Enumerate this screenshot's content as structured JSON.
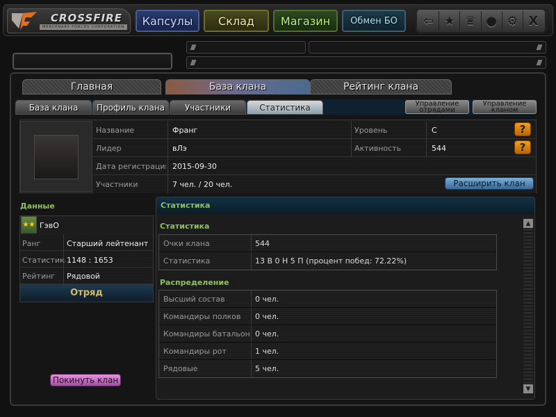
{
  "header": {
    "logo": {
      "title": "CROSSFIRE",
      "subtitle": "MERCENARY FORCES CORPORATION"
    },
    "nav": [
      {
        "label": "Капсулы",
        "color": "#4a5c90"
      },
      {
        "label": "Склад",
        "color": "#6e6e30"
      },
      {
        "label": "Магазин",
        "color": "#4e7030"
      },
      {
        "label": "Обмен БО",
        "color": "#3a6070"
      }
    ],
    "icons": [
      {
        "name": "back-arrow-icon",
        "glyph": "⇦"
      },
      {
        "name": "clan-shield-icon",
        "glyph": "★"
      },
      {
        "name": "trophy-icon",
        "glyph": "♛"
      },
      {
        "name": "friends-icon",
        "glyph": "●"
      },
      {
        "name": "settings-icon",
        "glyph": "⚙"
      },
      {
        "name": "close-icon",
        "glyph": "X"
      }
    ]
  },
  "tabs_main": [
    "Главная",
    "База клана",
    "Рейтинг клана"
  ],
  "tabs_main_active": 1,
  "tabs_sub": [
    "База клана",
    "Профиль клана",
    "Участники",
    "Статистика"
  ],
  "tabs_sub_active": 3,
  "manage": {
    "squads": "Управление отрядами",
    "clan": "Управление кланом"
  },
  "clan_info": {
    "name_label": "Название",
    "name": "Франг",
    "leader_label": "Лидер",
    "leader": "вЛэ",
    "reg_label": "Дата регистрации",
    "reg": "2015-09-30",
    "members_label": "Участники",
    "members": "7 чел. / 20 чел.",
    "level_label": "Уровень",
    "level": "C",
    "activity_label": "Активность",
    "activity": "544",
    "help_glyph": "?",
    "expand_button": "Расширить клан"
  },
  "player": {
    "section_title": "Данные",
    "nickname": "ГэвО",
    "rank_label": "Ранг",
    "rank": "Старший лейтенант",
    "stats_label": "Статистика",
    "stats": "1148 : 1653",
    "rating_label": "Рейтинг",
    "rating": "Рядовой",
    "squad_label": "Отряд",
    "leave_button": "Покинуть клан"
  },
  "stats": {
    "panel_title": "Статистика",
    "section1": "Статистика",
    "rows1": [
      {
        "label": "Очки клана",
        "value": "544"
      },
      {
        "label": "Статистика",
        "value": "13 В 0 Н 5 П (процент побед: 72.22%)"
      }
    ],
    "section2": "Распределение",
    "rows2": [
      {
        "label": "Высший состав",
        "value": "0 чел."
      },
      {
        "label": "Командиры полков",
        "value": "0 чел."
      },
      {
        "label": "Командиры батальонов",
        "value": "0 чел."
      },
      {
        "label": "Командиры рот",
        "value": "1 чел."
      },
      {
        "label": "Рядовые",
        "value": "5 чел."
      }
    ]
  },
  "scroll": {
    "up": "▲",
    "down": "▼"
  }
}
